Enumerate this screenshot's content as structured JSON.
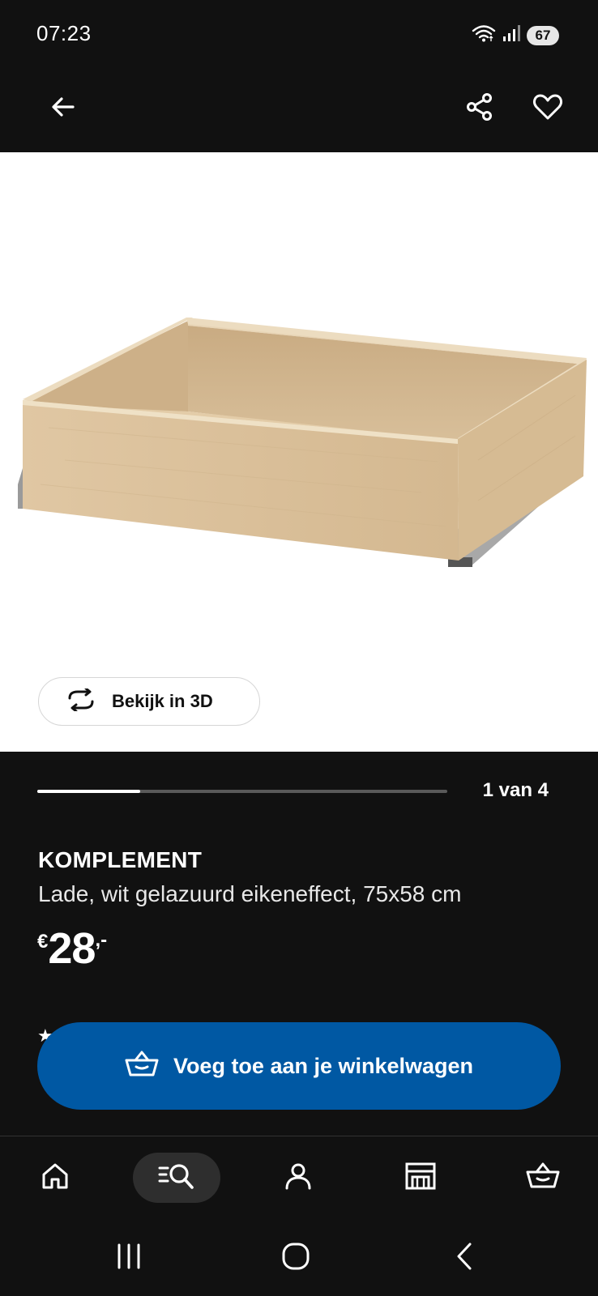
{
  "status_bar": {
    "time": "07:23",
    "battery": "67",
    "icons": [
      "wifi-icon",
      "signal-icon",
      "battery-icon"
    ]
  },
  "header": {
    "icons": [
      "back-arrow-icon",
      "share-icon",
      "heart-icon"
    ]
  },
  "product_media": {
    "view_3d_label": "Bekijk in 3D",
    "view_3d_icon": "rotate-3d-icon",
    "image_counter": "1 van 4",
    "progress_fraction": 0.25
  },
  "product": {
    "name": "KOMPLEMENT",
    "description": "Lade, wit gelazuurd eikeneffect, 75x58 cm",
    "price": {
      "currency": "€",
      "integer": "28",
      "decimal": ",-"
    }
  },
  "actions": {
    "add_to_cart_label": "Voeg toe aan je winkelwagen",
    "add_to_cart_icon": "basket-icon"
  },
  "bottom_nav": {
    "items": [
      {
        "icon": "home-icon",
        "selected": false
      },
      {
        "icon": "search-list-icon",
        "selected": true
      },
      {
        "icon": "account-icon",
        "selected": false
      },
      {
        "icon": "store-icon",
        "selected": false
      },
      {
        "icon": "basket-icon",
        "selected": false
      }
    ]
  },
  "system_nav": {
    "icons": [
      "recents-icon",
      "home-circle-icon",
      "back-chevron-icon"
    ]
  },
  "colors": {
    "background": "#111111",
    "primary_button": "#0058a3",
    "wood": "#d9c09b"
  }
}
